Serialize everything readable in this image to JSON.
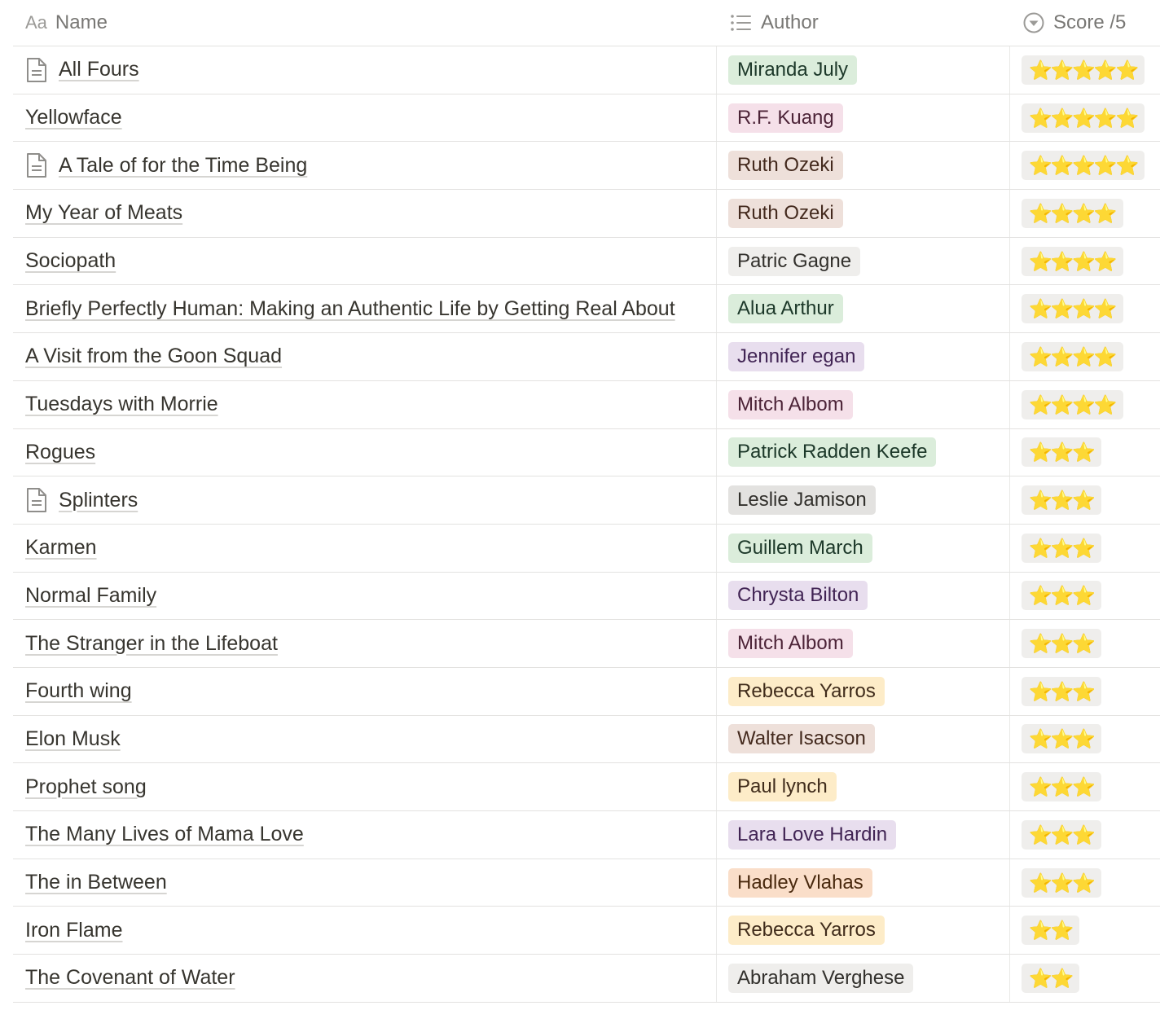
{
  "header": {
    "name_label": "Name",
    "name_icon": "Aa",
    "author_label": "Author",
    "score_label": "Score /5"
  },
  "rows": [
    {
      "name": "All Fours",
      "has_page": true,
      "author": "Miranda July",
      "author_color": "green",
      "stars": "⭐⭐⭐⭐⭐"
    },
    {
      "name": "Yellowface",
      "has_page": false,
      "author": "R.F. Kuang",
      "author_color": "pink",
      "stars": "⭐⭐⭐⭐⭐"
    },
    {
      "name": "A Tale of for the Time Being",
      "has_page": true,
      "author": "Ruth Ozeki",
      "author_color": "brown",
      "stars": "⭐⭐⭐⭐⭐"
    },
    {
      "name": "My Year of Meats",
      "has_page": false,
      "author": "Ruth Ozeki",
      "author_color": "brown",
      "stars": "⭐⭐⭐⭐"
    },
    {
      "name": "Sociopath",
      "has_page": false,
      "author": "Patric Gagne",
      "author_color": "gray",
      "stars": "⭐⭐⭐⭐"
    },
    {
      "name": "Briefly Perfectly Human: Making an Authentic Life by Getting Real About",
      "has_page": false,
      "author": "Alua Arthur",
      "author_color": "green",
      "stars": "⭐⭐⭐⭐"
    },
    {
      "name": "A Visit from the Goon Squad",
      "has_page": false,
      "author": "Jennifer egan",
      "author_color": "purple",
      "stars": "⭐⭐⭐⭐"
    },
    {
      "name": "Tuesdays with Morrie",
      "has_page": false,
      "author": "Mitch Albom",
      "author_color": "pink",
      "stars": "⭐⭐⭐⭐"
    },
    {
      "name": "Rogues",
      "has_page": false,
      "author": "Patrick Radden Keefe",
      "author_color": "green",
      "stars": "⭐⭐⭐"
    },
    {
      "name": "Splinters",
      "has_page": true,
      "author": "Leslie Jamison",
      "author_color": "dgray",
      "stars": "⭐⭐⭐"
    },
    {
      "name": "Karmen",
      "has_page": false,
      "author": "Guillem March",
      "author_color": "green",
      "stars": "⭐⭐⭐"
    },
    {
      "name": "Normal Family",
      "has_page": false,
      "author": "Chrysta Bilton",
      "author_color": "purple",
      "stars": "⭐⭐⭐"
    },
    {
      "name": "The Stranger in the Lifeboat",
      "has_page": false,
      "author": "Mitch Albom",
      "author_color": "pink",
      "stars": "⭐⭐⭐"
    },
    {
      "name": "Fourth wing",
      "has_page": false,
      "author": "Rebecca Yarros",
      "author_color": "yellow",
      "stars": "⭐⭐⭐"
    },
    {
      "name": "Elon Musk",
      "has_page": false,
      "author": "Walter Isacson",
      "author_color": "brown",
      "stars": "⭐⭐⭐"
    },
    {
      "name": "Prophet song",
      "has_page": false,
      "author": "Paul lynch",
      "author_color": "yellow",
      "stars": "⭐⭐⭐"
    },
    {
      "name": "The Many Lives of Mama Love",
      "has_page": false,
      "author": "Lara Love Hardin",
      "author_color": "purple",
      "stars": "⭐⭐⭐"
    },
    {
      "name": "The in Between",
      "has_page": false,
      "author": "Hadley Vlahas",
      "author_color": "orange",
      "stars": "⭐⭐⭐"
    },
    {
      "name": "Iron Flame",
      "has_page": false,
      "author": "Rebecca Yarros",
      "author_color": "yellow",
      "stars": "⭐⭐"
    },
    {
      "name": "The Covenant of Water",
      "has_page": false,
      "author": "Abraham Verghese",
      "author_color": "gray",
      "stars": "⭐⭐"
    }
  ]
}
